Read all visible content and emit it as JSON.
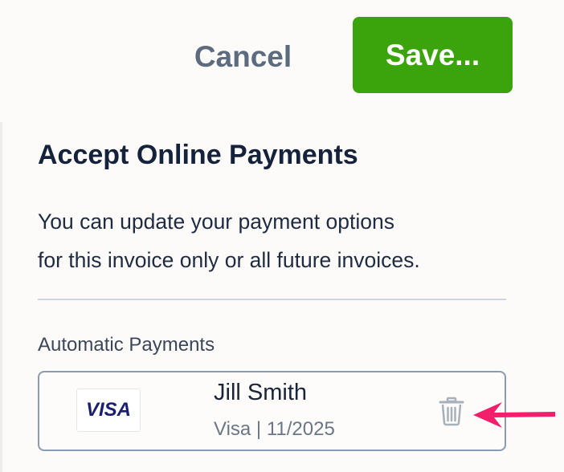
{
  "toolbar": {
    "cancel_label": "Cancel",
    "save_label": "Save...",
    "save_color": "#3ba40d"
  },
  "panel": {
    "title": "Accept Online Payments",
    "description_line1": "You can update your payment options",
    "description_line2": "for this invoice only or all future invoices.",
    "section_label": "Automatic Payments"
  },
  "card": {
    "brand_logo_text": "VISA",
    "holder_name": "Jill Smith",
    "details": "Visa | 11/2025",
    "delete_icon": "trash-icon"
  },
  "annotation": {
    "icon": "arrow-left-icon",
    "color": "#f2206a"
  }
}
